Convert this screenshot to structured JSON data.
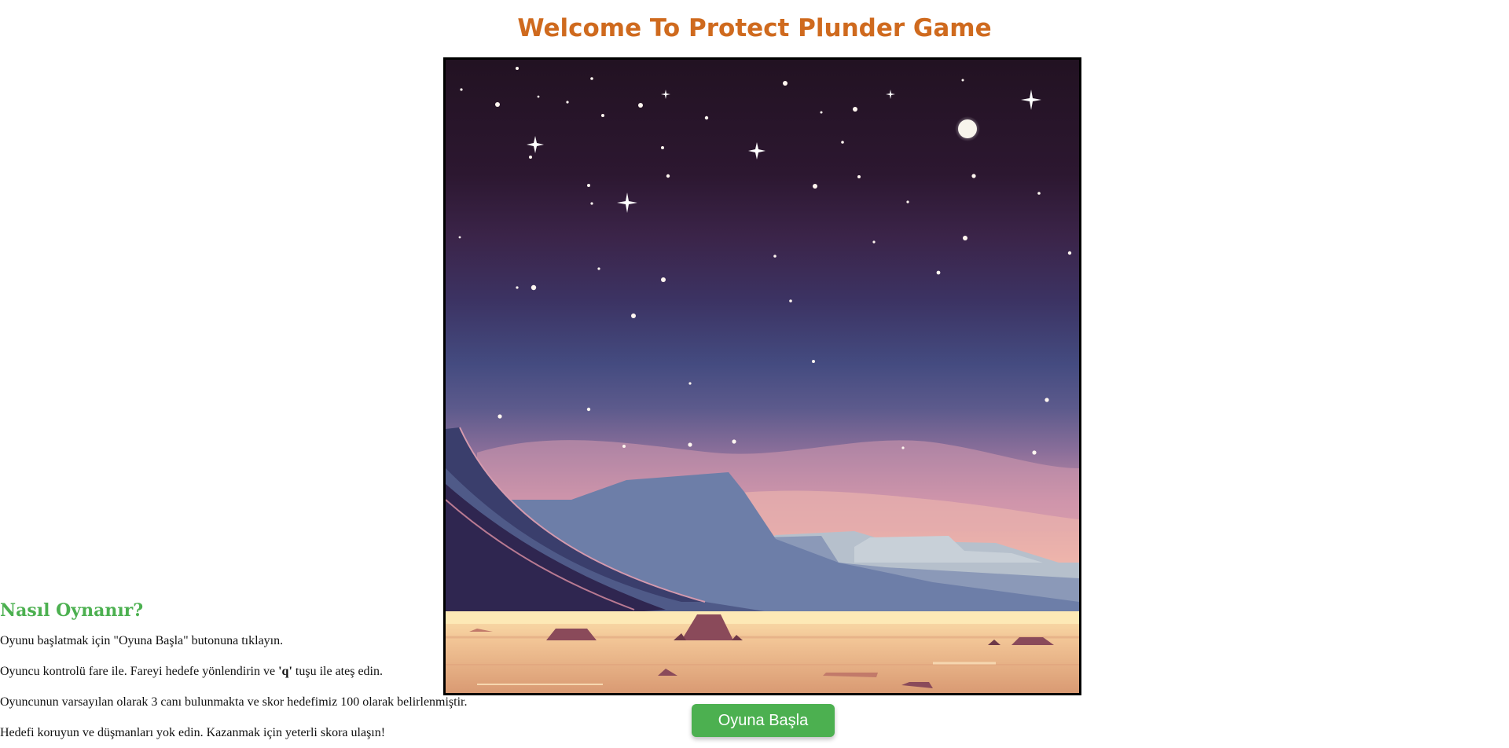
{
  "page": {
    "title": "Welcome To Protect Plunder Game"
  },
  "game": {
    "scene": "night-desert-background",
    "colors": {
      "title": "#cf6a1e",
      "accent_green": "#4cb050",
      "frame_border": "#000000"
    }
  },
  "controls": {
    "start_label": "Oyuna Başla"
  },
  "howto": {
    "heading": "Nasıl Oynanır?",
    "line1": "Oyunu başlatmak için \"Oyuna Başla\" butonuna tıklayın.",
    "line2_before": "Oyuncu kontrolü fare ile. Fareyi hedefe yönlendirin ve ",
    "line2_key": "'q'",
    "line2_after": " tuşu ile ateş edin.",
    "line3": "Oyuncunun varsayılan olarak 3 canı bulunmakta ve skor hedefimiz 100 olarak belirlenmiştir.",
    "line4": "Hedefi koruyun ve düşmanları yok edin. Kazanmak için yeterli skora ulaşın!"
  }
}
